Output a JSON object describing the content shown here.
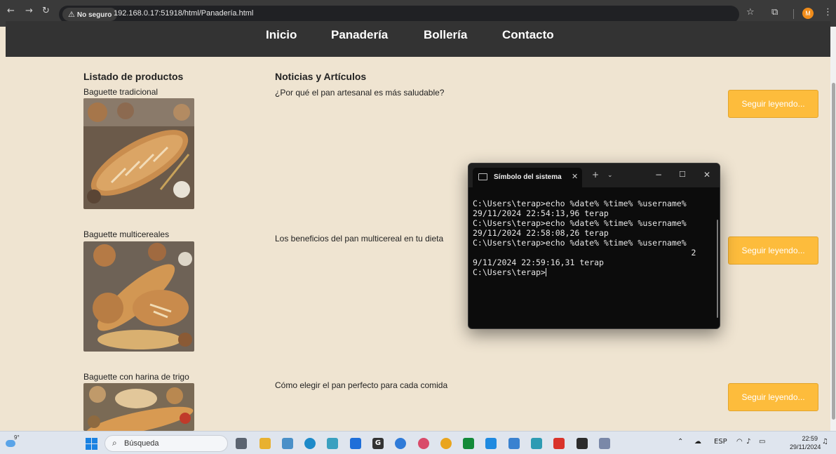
{
  "browser": {
    "security_label": "No seguro",
    "url": "192.168.0.17:51918/html/Panadería.html",
    "profile_initial": "M"
  },
  "nav": {
    "items": [
      "Inicio",
      "Panadería",
      "Bollería",
      "Contacto"
    ]
  },
  "products": {
    "heading": "Listado de productos",
    "items": [
      {
        "name": "Baguette tradicional"
      },
      {
        "name": "Baguette multicereales"
      },
      {
        "name": "Baguette con harina de trigo"
      }
    ]
  },
  "news": {
    "heading": "Noticias y Artículos",
    "items": [
      {
        "title": "¿Por qué el pan artesanal es más saludable?",
        "button": "Seguir leyendo..."
      },
      {
        "title": "Los beneficios del pan multicereal en tu dieta",
        "button": "Seguir leyendo..."
      },
      {
        "title": "Cómo elegir el pan perfecto para cada comida",
        "button": "Seguir leyendo..."
      }
    ]
  },
  "terminal": {
    "tab_title": "Símbolo del sistema",
    "lines": [
      "C:\\Users\\terap>echo %date% %time% %username%",
      "29/11/2024 22:54:13,96 terap",
      "",
      "C:\\Users\\terap>echo %date% %time% %username%",
      "29/11/2024 22:58:08,26 terap",
      "",
      "",
      "",
      "C:\\Users\\terap>echo %date% %time% %username%",
      "                                             2",
      "9/11/2024 22:59:16,31 terap",
      "",
      "C:\\Users\\terap>"
    ]
  },
  "taskbar": {
    "weather_temp": "9°",
    "search_label": "Búsqueda",
    "language": "ESP",
    "time": "22:59",
    "date": "29/11/2024"
  },
  "colors": {
    "page_bg": "#efe4d1",
    "nav_bg": "#333333",
    "button_bg": "#fdbc3c",
    "terminal_bg": "#0c0c0c"
  }
}
